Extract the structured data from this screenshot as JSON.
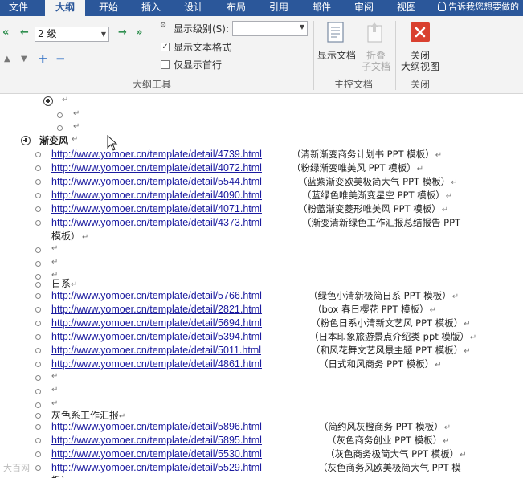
{
  "tabs": [
    "文件",
    "大纲",
    "开始",
    "插入",
    "设计",
    "布局",
    "引用",
    "邮件",
    "审阅",
    "视图"
  ],
  "tell_me": "告诉我您想要做的",
  "outline_tools": {
    "level_value": "2 级",
    "show_level_label": "显示级别(S):",
    "show_text_format_label": "显示文本格式",
    "show_first_line_label": "仅显示首行",
    "group_label": "大纲工具"
  },
  "master_document": {
    "show_document_label": "显示文档",
    "collapse_subdoc_label": "折叠\n子文档",
    "group_label": "主控文档"
  },
  "close": {
    "close_outline_label": "关闭\n大纲视图",
    "group_label": "关闭"
  },
  "document": {
    "section1_title": "渐变风",
    "section1_rows": [
      {
        "url": "http://www.yomoer.cn/template/detail/4739.html",
        "desc": "（清新渐变商务计划书 PPT 模板）"
      },
      {
        "url": "http://www.yomoer.cn/template/detail/4072.html",
        "desc": "（粉绿渐变唯美风 PPT 模板）"
      },
      {
        "url": "http://www.yomoer.cn/template/detail/5544.html",
        "desc": "（蓝紫渐变欧美极简大气 PPT 模板）"
      },
      {
        "url": "http://www.yomoer.cn/template/detail/4090.html",
        "desc": "（蓝绿色唯美渐变星空 PPT 模板）"
      },
      {
        "url": "http://www.yomoer.cn/template/detail/4071.html",
        "desc": "（粉蓝渐变菱形唯美风 PPT 模板）"
      },
      {
        "url": "http://www.yomoer.cn/template/detail/4373.html",
        "desc": "（渐变清新绿色工作汇报总结报告 PPT"
      }
    ],
    "section1_wrap": "模板）",
    "section2_title": "日系",
    "section2_rows": [
      {
        "url": "http://www.yomoer.cn/template/detail/5766.html",
        "desc": "（绿色小清新极简日系 PPT 模板）"
      },
      {
        "url": "http://www.yomoer.cn/template/detail/2821.html",
        "desc": "（box 春日樱花 PPT 模板）"
      },
      {
        "url": "http://www.yomoer.cn/template/detail/5694.html",
        "desc": "（粉色日系小清新文艺风 PPT 模板）"
      },
      {
        "url": "http://www.yomoer.cn/template/detail/5394.html",
        "desc": "（日本印象旅游景点介绍类 ppt 模版）"
      },
      {
        "url": "http://www.yomoer.cn/template/detail/5011.html",
        "desc": "（和风花舞文艺风景主题 PPT 模板）"
      },
      {
        "url": "http://www.yomoer.cn/template/detail/4861.html",
        "desc": "（日式和风商务 PPT 模板）"
      }
    ],
    "section3_title": "灰色系工作汇报",
    "section3_rows": [
      {
        "url": "http://www.yomoer.cn/template/detail/5896.html",
        "desc": "（简约风灰橙商务 PPT 模板）"
      },
      {
        "url": "http://www.yomoer.cn/template/detail/5895.html",
        "desc": "（灰色商务创业 PPT 模板）"
      },
      {
        "url": "http://www.yomoer.cn/template/detail/5530.html",
        "desc": "（灰色商务极简大气 PPT 模板）"
      },
      {
        "url": "http://www.yomoer.cn/template/detail/5529.html",
        "desc": "（灰色商务风欧美极简大气 PPT 模"
      }
    ],
    "section3_wrap": "板）"
  },
  "watermark": "大百网",
  "colors": {
    "ribbon_blue": "#2b579a",
    "link_blue": "#1a1a9f",
    "close_red": "#d9402f",
    "arrow_green": "#2f8f4f"
  }
}
